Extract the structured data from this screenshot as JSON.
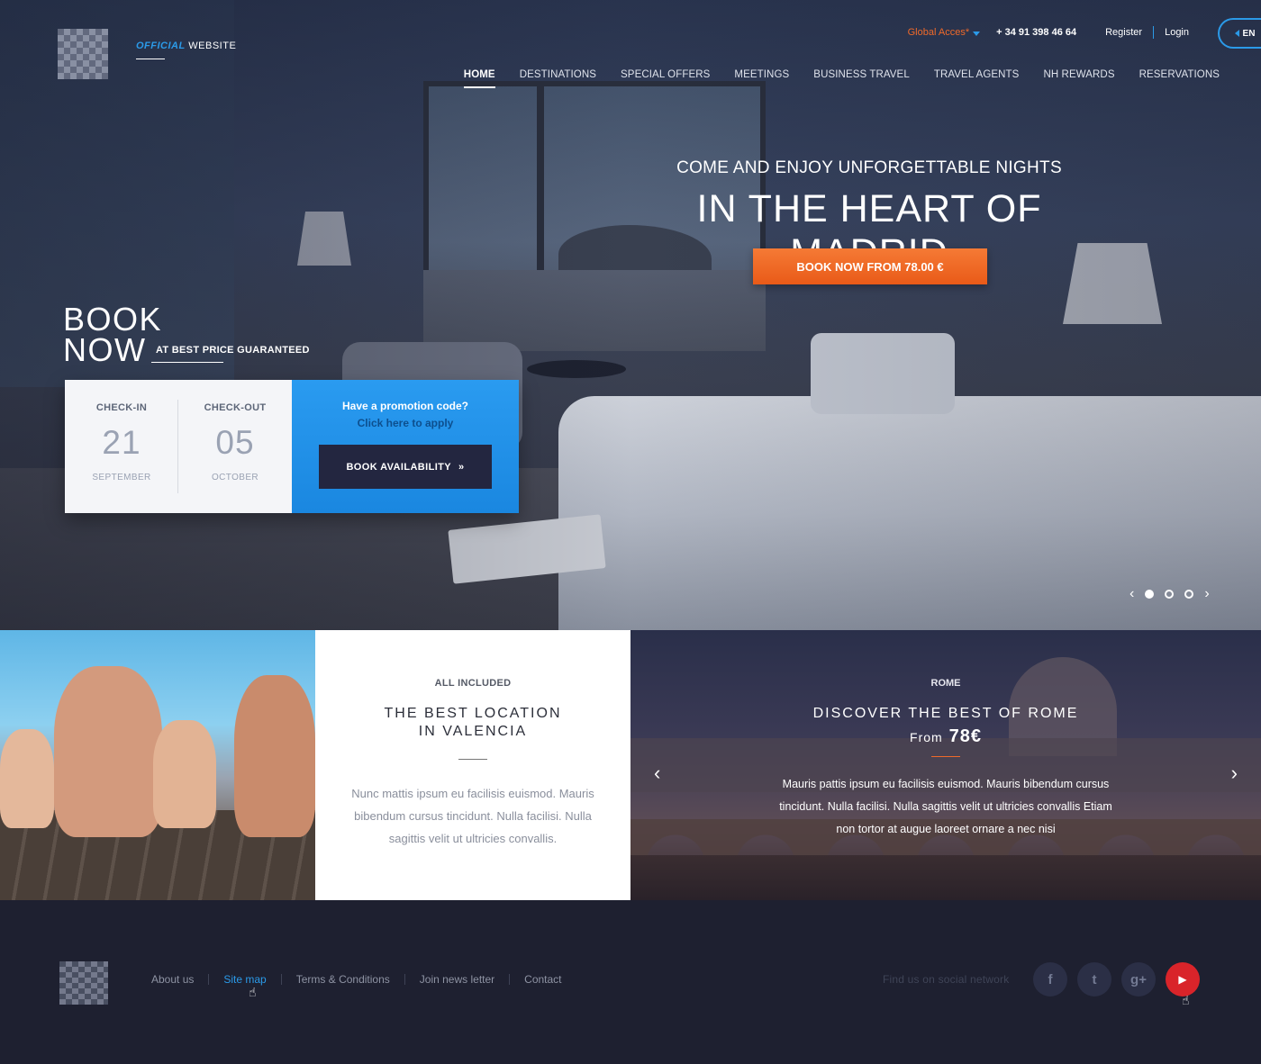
{
  "header": {
    "official_1": "OFFICIAL",
    "official_2": "WEBSITE",
    "global_access": "Global Acces*",
    "phone": "+ 34 91 398 46 64",
    "register": "Register",
    "login": "Login",
    "language": "EN"
  },
  "nav": [
    "HOME",
    "DESTINATIONS",
    "SPECIAL OFFERS",
    "MEETINGS",
    "BUSINESS TRAVEL",
    "TRAVEL AGENTS",
    "NH REWARDS",
    "RESERVATIONS"
  ],
  "hero": {
    "subtitle": "COME AND ENJOY UNFORGETTABLE NIGHTS",
    "title": "IN THE HEART OF MADRID",
    "cta": "BOOK NOW FROM 78.00 €",
    "slides_total": 3,
    "slide_active": 1
  },
  "booking": {
    "book": "BOOK",
    "now": "NOW",
    "best_price": "AT BEST PRICE GUARANTEED",
    "checkin_label": "CHECK-IN",
    "checkin_day": "21",
    "checkin_month": "SEPTEMBER",
    "checkout_label": "CHECK-OUT",
    "checkout_day": "05",
    "checkout_month": "OCTOBER",
    "promo_question": "Have a promotion code?",
    "promo_link": "Click here to apply",
    "availability_button": "BOOK AVAILABILITY"
  },
  "valencia": {
    "tag": "ALL INCLUDED",
    "title_1": "THE BEST LOCATION",
    "title_2": "IN VALENCIA",
    "text": "Nunc mattis ipsum eu facilisis euismod. Mauris bibendum cursus tincidunt. Nulla facilisi. Nulla sagittis velit ut ultricies convallis."
  },
  "rome": {
    "tag": "ROME",
    "title": "DISCOVER THE BEST OF ROME",
    "from_label": "From",
    "price": "78€",
    "text": "Mauris pattis ipsum eu facilisis euismod. Mauris bibendum cursus tincidunt. Nulla facilisi. Nulla sagittis velit ut ultricies convallis Etiam non tortor at augue laoreet ornare a nec nisi"
  },
  "footer": {
    "links": [
      "About us",
      "Site map",
      "Terms & Conditions",
      "Join news letter",
      "Contact"
    ],
    "find_us": "Find us on social network",
    "social": [
      "f",
      "t",
      "g+",
      "▶"
    ]
  },
  "colors": {
    "accent_blue": "#2b9ae8",
    "accent_orange": "#f06a2a",
    "footer_bg": "#1e2030",
    "youtube_red": "#d9242a"
  }
}
